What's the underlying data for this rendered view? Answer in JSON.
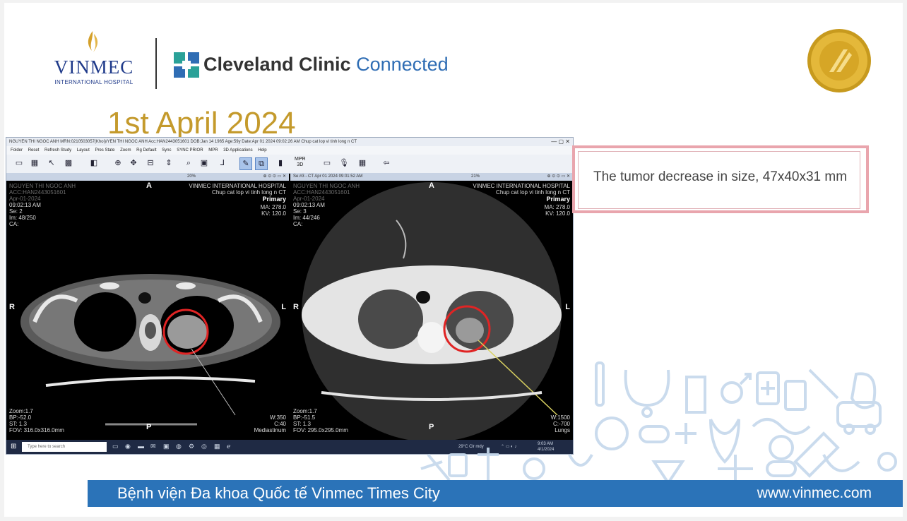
{
  "header": {
    "vinmec_name": "VINMEC",
    "vinmec_sub": "INTERNATIONAL HOSPITAL",
    "partner_bold": "Cleveland Clinic",
    "partner_light": "Connected",
    "date_title": "1st April 2024"
  },
  "viewer_window": {
    "title": "NGUYEN THI NGOC ANH   MRN:0210503057(Khoi)/YEN THI NGOC ANH   Acc:HAN2443051601   DOB:Jan 14 1965   Age:59y   Date:Apr 01 2024   09:02:26 AM   Chup cat lop vi tinh long n CT",
    "menu": [
      "Folder",
      "Reset",
      "Refresh Study",
      "Layout",
      "Pres State",
      "Zoom",
      "Rg Default",
      "Sync",
      "SYNC PRIOR",
      "MPR",
      "3D Applications",
      "Help"
    ],
    "mpr_label_top": "MPR",
    "mpr_label_bottom": "3D",
    "left": {
      "header_pct": "20%",
      "patient": "NGUYEN THI NGOC ANH",
      "acc": "ACC:HAN2443051601",
      "date": "Apr-01-2024",
      "time": "09:02:13 AM",
      "se": "Se: 2",
      "im": "Im: 48/250",
      "ca": "CA:",
      "hospital": "VINMEC INTERNATIONAL HOSPITAL",
      "study": "Chup cat lop vi tinh long n CT",
      "primary": "Primary",
      "ma": "MA: 278.0",
      "kv": "KV: 120.0",
      "orient_a": "A",
      "orient_r": "R",
      "orient_l": "L",
      "orient_p": "P",
      "zoom": "Zoom:1.7",
      "bp": "BP:-52.0",
      "st": "ST:   1.3",
      "fov": "FOV: 316.0x316.0mm",
      "w": "W:350",
      "c": "C:40",
      "preset": "Mediastinum"
    },
    "right": {
      "header_series": "Se:#3 - CT Apr 01 2024 09:01:52 AM",
      "header_pct": "21%",
      "patient": "NGUYEN THI NGOC ANH",
      "acc": "ACC:HAN2443051601",
      "date": "Apr-01-2024",
      "time": "09:02:13 AM",
      "se": "Se: 3",
      "im": "Im: 44/246",
      "ca": "CA:",
      "hospital": "VINMEC INTERNATIONAL HOSPITAL",
      "study": "Chup cat lop vi tinh long n CT",
      "primary": "Primary",
      "ma": "MA: 278.0",
      "kv": "KV: 120.0",
      "orient_a": "A",
      "orient_r": "R",
      "orient_l": "L",
      "orient_p": "P",
      "zoom": "Zoom:1.7",
      "bp": "BP:-51.5",
      "st": "ST:   1.3",
      "fov": "FOV: 295.0x295.0mm",
      "w": "W:1500",
      "c": "C:-700",
      "preset": "Lungs"
    },
    "taskbar": {
      "search_placeholder": "Type here to search",
      "weather": "29°C  Clr mdy",
      "time": "9:03 AM",
      "date": "4/1/2024"
    }
  },
  "finding": {
    "text": "The tumor decrease in size, 47x40x31 mm"
  },
  "footer": {
    "hospital": "Bệnh viện Đa khoa Quốc tế Vinmec Times City",
    "website": "www.vinmec.com"
  },
  "colors": {
    "title_gold": "#c49a2c",
    "brand_blue": "#2b73b8",
    "vinmec_navy": "#1f3a8a",
    "tumor_circle": "#e02424",
    "finding_border": "#e9a5ad"
  }
}
